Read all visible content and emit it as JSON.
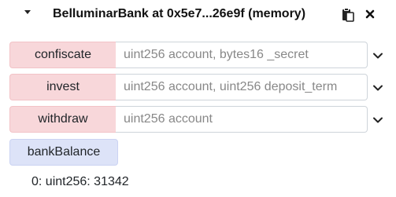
{
  "instance": {
    "title": "BelluminarBank at 0x5e7...26e9f (memory)",
    "icons": {
      "collapse": "caret-down-icon",
      "copy": "clipboard-copy-icon",
      "close": "close-icon"
    }
  },
  "functions": [
    {
      "label": "confiscate",
      "placeholder": "uint256 account, bytes16 _secret",
      "value": ""
    },
    {
      "label": "invest",
      "placeholder": "uint256 account, uint256 deposit_term",
      "value": ""
    },
    {
      "label": "withdraw",
      "placeholder": "uint256 account",
      "value": ""
    }
  ],
  "calls": [
    {
      "label": "bankBalance",
      "result": "0: uint256: 31342"
    }
  ],
  "colors": {
    "transact_button": "#f8d7da",
    "call_button": "#dde3f8"
  }
}
